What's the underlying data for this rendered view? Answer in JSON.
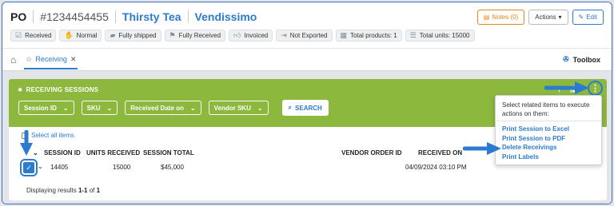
{
  "header": {
    "po_label": "PO",
    "po_number": "#1234454455",
    "buyer": "Thirsty Tea",
    "vendor": "Vendissimo",
    "notes_label": "Notes (0)",
    "actions_label": "Actions",
    "edit_label": "Edit"
  },
  "badges": [
    {
      "label": "Received",
      "icon": "check-square-icon"
    },
    {
      "label": "Normal",
      "icon": "hand-icon"
    },
    {
      "label": "Fully shipped",
      "icon": "truck-icon"
    },
    {
      "label": "Fully Received",
      "icon": "flag-icon"
    },
    {
      "label": "Invoiced",
      "icon": "thumbs-up-icon"
    },
    {
      "label": "Not Exported",
      "icon": "export-icon"
    },
    {
      "label": "Total products: 1",
      "icon": "boxes-icon"
    },
    {
      "label": "Total units: 15000",
      "icon": "stack-icon"
    }
  ],
  "tabs": {
    "active_label": "Receiving",
    "toolbox_label": "Toolbox"
  },
  "panel": {
    "title": "RECEIVING SESSIONS",
    "filters": [
      "Session ID",
      "SKU",
      "Received Date on",
      "Vendor SKU"
    ],
    "search_label": "SEARCH",
    "select_all_label": "Select all items"
  },
  "table": {
    "columns": [
      "SESSION ID",
      "UNITS RECEIVED",
      "SESSION TOTAL",
      "VENDOR ORDER ID",
      "RECEIVED ON"
    ],
    "rows": [
      {
        "session_id": "14405",
        "units_received": "15000",
        "session_total": "$45,000",
        "vendor_order_id": "",
        "received_on": "04/09/2024 03:10 PM"
      }
    ],
    "footer_prefix": "Displaying results",
    "footer_range": "1-1",
    "footer_of": "of",
    "footer_total": "1"
  },
  "popover": {
    "hint": "Select related items to execute actions on them:",
    "items": [
      "Print Session to Excel",
      "Print Session to PDF",
      "Delete Receivings",
      "Print Labels"
    ]
  },
  "colors": {
    "accent": "#2b7bd0",
    "panel_green": "#8cb83e",
    "notes_orange": "#e38a1c"
  }
}
